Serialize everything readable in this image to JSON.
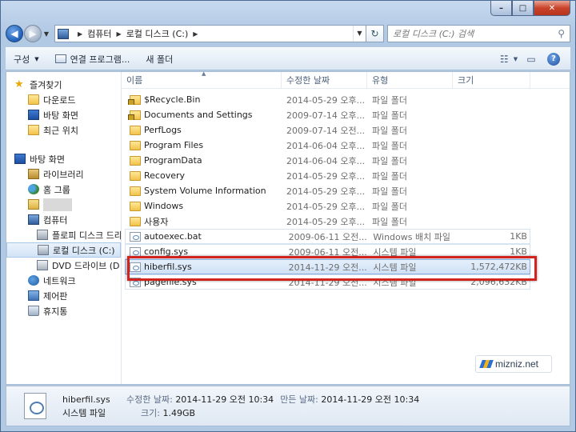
{
  "window": {
    "caption": {
      "minimize": "–",
      "maximize": "□",
      "close": "✕"
    }
  },
  "address": {
    "crumbs": [
      "컴퓨터",
      "로컬 디스크 (C:)"
    ],
    "search_placeholder": "로컬 디스크 (C:) 검색"
  },
  "toolbar": {
    "organize": "구성",
    "open_with": "연결 프로그램...",
    "new_folder": "새 폴더"
  },
  "nav": {
    "favorites": "즐겨찾기",
    "downloads": "다운로드",
    "desktop_fav": "바탕 화면",
    "recent": "최근 위치",
    "desktop": "바탕 화면",
    "libraries": "라이브러리",
    "homegroup": "홈 그룹",
    "computer": "컴퓨터",
    "floppy": "플로피 디스크 드라",
    "local_disk": "로컬 디스크 (C:)",
    "dvd": "DVD 드라이브 (D",
    "network": "네트워크",
    "control_panel": "제어판",
    "recycle_bin": "휴지통"
  },
  "columns": {
    "name": "이름",
    "date": "수정한 날짜",
    "type": "유형",
    "size": "크기"
  },
  "files": [
    {
      "name": "$Recycle.Bin",
      "date": "2014-05-29 오후...",
      "type": "파일 폴더",
      "size": "",
      "icon": "folder-lock"
    },
    {
      "name": "Documents and Settings",
      "date": "2009-07-14 오후...",
      "type": "파일 폴더",
      "size": "",
      "icon": "folder-lock"
    },
    {
      "name": "PerfLogs",
      "date": "2009-07-14 오전...",
      "type": "파일 폴더",
      "size": "",
      "icon": "folder"
    },
    {
      "name": "Program Files",
      "date": "2014-06-04 오후...",
      "type": "파일 폴더",
      "size": "",
      "icon": "folder"
    },
    {
      "name": "ProgramData",
      "date": "2014-06-04 오후...",
      "type": "파일 폴더",
      "size": "",
      "icon": "folder"
    },
    {
      "name": "Recovery",
      "date": "2014-05-29 오후...",
      "type": "파일 폴더",
      "size": "",
      "icon": "folder"
    },
    {
      "name": "System Volume Information",
      "date": "2014-05-29 오후...",
      "type": "파일 폴더",
      "size": "",
      "icon": "folder"
    },
    {
      "name": "Windows",
      "date": "2014-05-29 오후...",
      "type": "파일 폴더",
      "size": "",
      "icon": "folder"
    },
    {
      "name": "사용자",
      "date": "2014-05-29 오후...",
      "type": "파일 폴더",
      "size": "",
      "icon": "folder"
    },
    {
      "name": "autoexec.bat",
      "date": "2009-06-11 오전...",
      "type": "Windows 배치 파일",
      "size": "1KB",
      "icon": "file"
    },
    {
      "name": "config.sys",
      "date": "2009-06-11 오전...",
      "type": "시스템 파일",
      "size": "1KB",
      "icon": "file"
    },
    {
      "name": "hiberfil.sys",
      "date": "2014-11-29 오전...",
      "type": "시스템 파일",
      "size": "1,572,472KB",
      "icon": "file"
    },
    {
      "name": "pagefile.sys",
      "date": "2014-11-29 오전...",
      "type": "시스템 파일",
      "size": "2,096,632KB",
      "icon": "file"
    }
  ],
  "watermark": "mizniz.net",
  "details": {
    "name": "hiberfil.sys",
    "type": "시스템 파일",
    "modified_label": "수정한 날짜:",
    "modified": "2014-11-29 오전 10:34",
    "created_label": "만든 날짜:",
    "created": "2014-11-29 오전 10:34",
    "size_label": "크기:",
    "size": "1.49GB"
  },
  "colors": {
    "highlight": "#d2231c",
    "selection": "#cfe1f6"
  }
}
